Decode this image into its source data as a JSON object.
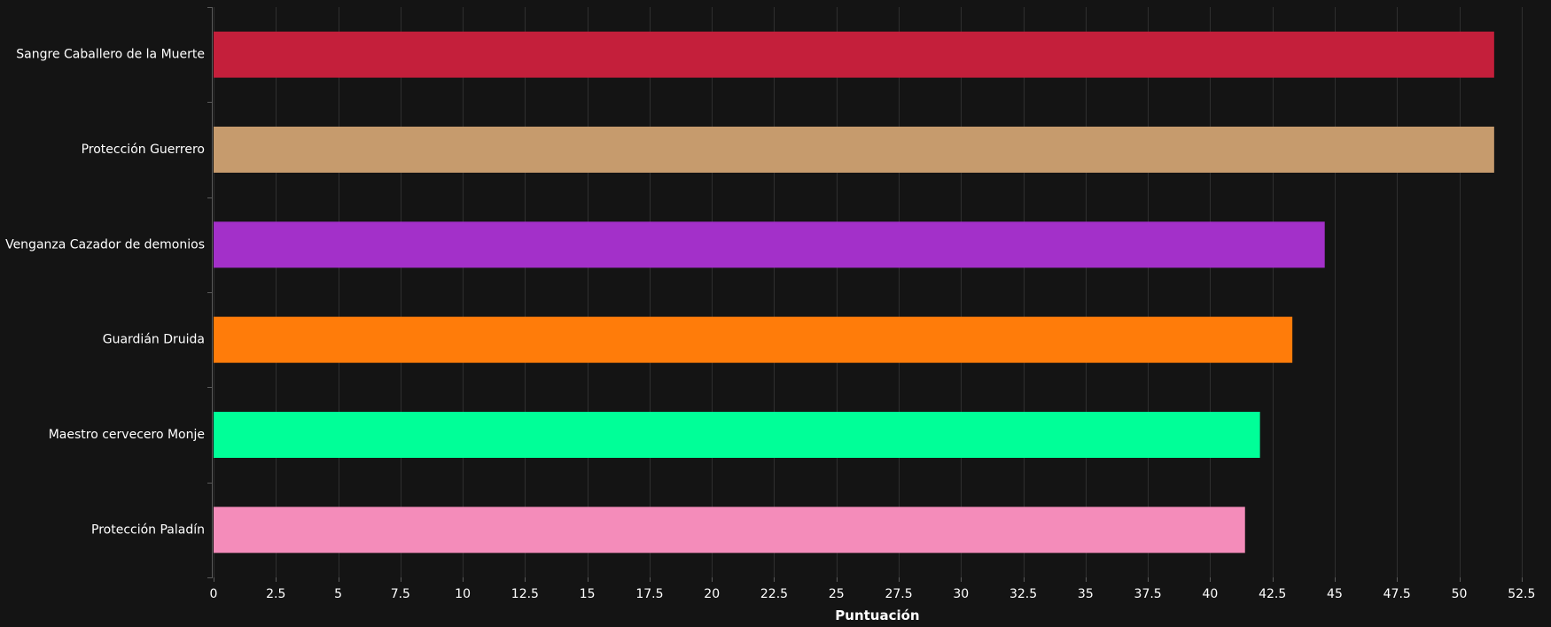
{
  "chart_data": {
    "type": "bar",
    "orientation": "horizontal",
    "title": "",
    "xlabel": "Puntuación",
    "ylabel": "",
    "xlim": [
      0,
      53.5
    ],
    "xticks": [
      0,
      2.5,
      5,
      7.5,
      10,
      12.5,
      15,
      17.5,
      20,
      22.5,
      25,
      27.5,
      30,
      32.5,
      35,
      37.5,
      40,
      42.5,
      45,
      47.5,
      50,
      52.5
    ],
    "xtick_labels": [
      "0",
      "2.5",
      "5",
      "7.5",
      "10",
      "12.5",
      "15",
      "17.5",
      "20",
      "22.5",
      "25",
      "27.5",
      "30",
      "32.5",
      "35",
      "37.5",
      "40",
      "42.5",
      "45",
      "47.5",
      "50",
      "52.5"
    ],
    "grid": true,
    "legend": "none",
    "categories": [
      "Sangre Caballero de la Muerte",
      "Protección Guerrero",
      "Venganza Cazador de demonios",
      "Guardián Druida",
      "Maestro cervecero Monje",
      "Protección Paladín"
    ],
    "values": [
      51.4,
      51.4,
      44.6,
      43.3,
      42.0,
      41.4
    ],
    "colors": [
      "#c41f3b",
      "#c69b6d",
      "#a330c9",
      "#ff7c0a",
      "#00ff98",
      "#f48cba"
    ]
  },
  "theme": {
    "background": "#141414",
    "text": "#ffffff",
    "grid": "#2f2f2f"
  }
}
